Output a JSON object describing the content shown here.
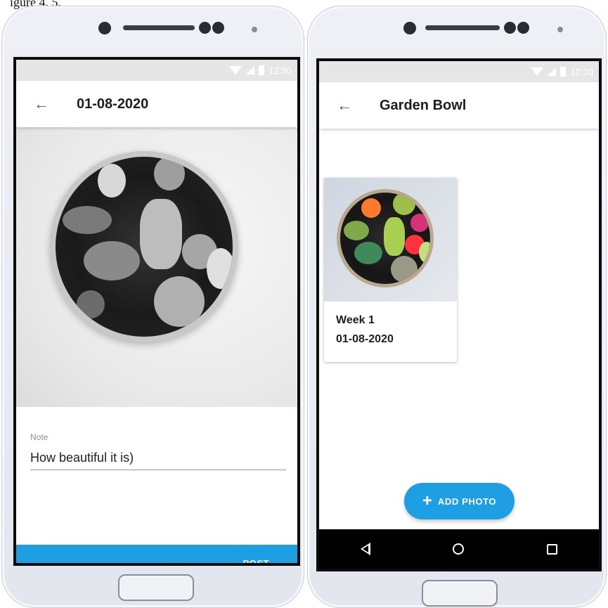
{
  "caption": "igure 4, 5,",
  "left_screen": {
    "status_time": "12:30",
    "title": "01-08-2020",
    "note_label": "Note",
    "note_value": "How beautiful it is)",
    "bottom_button_label": "POST"
  },
  "right_screen": {
    "status_time": "12:30",
    "title": "Garden Bowl",
    "cards": [
      {
        "week": "Week 1",
        "date": "01-08-2020"
      }
    ],
    "fab_label": "ADD PHOTO",
    "fab_icon": "plus-icon"
  },
  "icons": {
    "back": "arrow-left-icon",
    "nav": [
      "triangle-back-icon",
      "circle-home-icon",
      "square-recents-icon"
    ]
  },
  "colors": {
    "accent": "#1e9fe3",
    "status_bar": "#e6e6e6",
    "nav_bar": "#000000"
  }
}
